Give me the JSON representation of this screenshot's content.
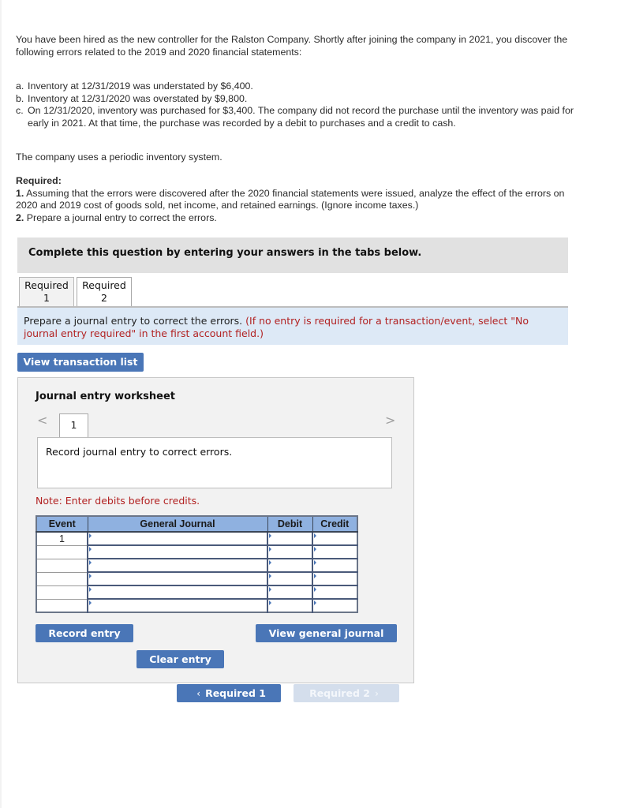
{
  "intro": "You have been hired as the new controller for the Ralston Company. Shortly after joining the company in 2021, you discover the following errors related to the 2019 and 2020 financial statements:",
  "errors": [
    {
      "label": "a.",
      "text": "Inventory at 12/31/2019 was understated by $6,400."
    },
    {
      "label": "b.",
      "text": "Inventory at 12/31/2020 was overstated by $9,800."
    },
    {
      "label": "c.",
      "text": "On 12/31/2020, inventory was purchased for $3,400. The company did not record the purchase until the inventory was paid for early in 2021. At that time, the purchase was recorded by a debit to purchases and a credit to cash."
    }
  ],
  "system_note": "The company uses a periodic inventory system.",
  "required": {
    "heading": "Required:",
    "items": [
      {
        "num": "1.",
        "text": "Assuming that the errors were discovered after the 2020 financial statements were issued, analyze the effect of the errors on 2020 and 2019 cost of goods sold, net income, and retained earnings. (Ignore income taxes.)"
      },
      {
        "num": "2.",
        "text": "Prepare a journal entry to correct the errors."
      }
    ]
  },
  "banner": "Complete this question by entering your answers in the tabs below.",
  "tabs": [
    {
      "line1": "Required",
      "line2": "1",
      "active": false
    },
    {
      "line1": "Required",
      "line2": "2",
      "active": true
    }
  ],
  "instruction": {
    "main": "Prepare a journal entry to correct the errors.",
    "hint": "(If no entry is required for a transaction/event, select \"No journal entry required\" in the first account field.)"
  },
  "view_transaction_list": "View transaction list",
  "worksheet": {
    "title": "Journal entry worksheet",
    "prev_icon": "chevron-left-icon",
    "next_icon": "chevron-right-icon",
    "page": "1",
    "description": "Record journal entry to correct errors.",
    "note": "Note: Enter debits before credits.",
    "columns": [
      "Event",
      "General Journal",
      "Debit",
      "Credit"
    ],
    "rows": [
      {
        "event": "1",
        "account": "",
        "debit": "",
        "credit": ""
      },
      {
        "event": "",
        "account": "",
        "debit": "",
        "credit": ""
      },
      {
        "event": "",
        "account": "",
        "debit": "",
        "credit": ""
      },
      {
        "event": "",
        "account": "",
        "debit": "",
        "credit": ""
      },
      {
        "event": "",
        "account": "",
        "debit": "",
        "credit": ""
      },
      {
        "event": "",
        "account": "",
        "debit": "",
        "credit": ""
      }
    ],
    "record_entry": "Record entry",
    "clear_entry": "Clear entry",
    "view_general_journal": "View general journal"
  },
  "nav": {
    "prev_label": "Required 1",
    "next_label": "Required 2",
    "prev_icon": "‹",
    "next_icon": "›"
  },
  "colors": {
    "button": "#4a76b7",
    "button_disabled": "#d4deec",
    "hint_red": "#b22222",
    "instruction_bg": "#dde9f6",
    "table_header": "#8fb1e0"
  }
}
